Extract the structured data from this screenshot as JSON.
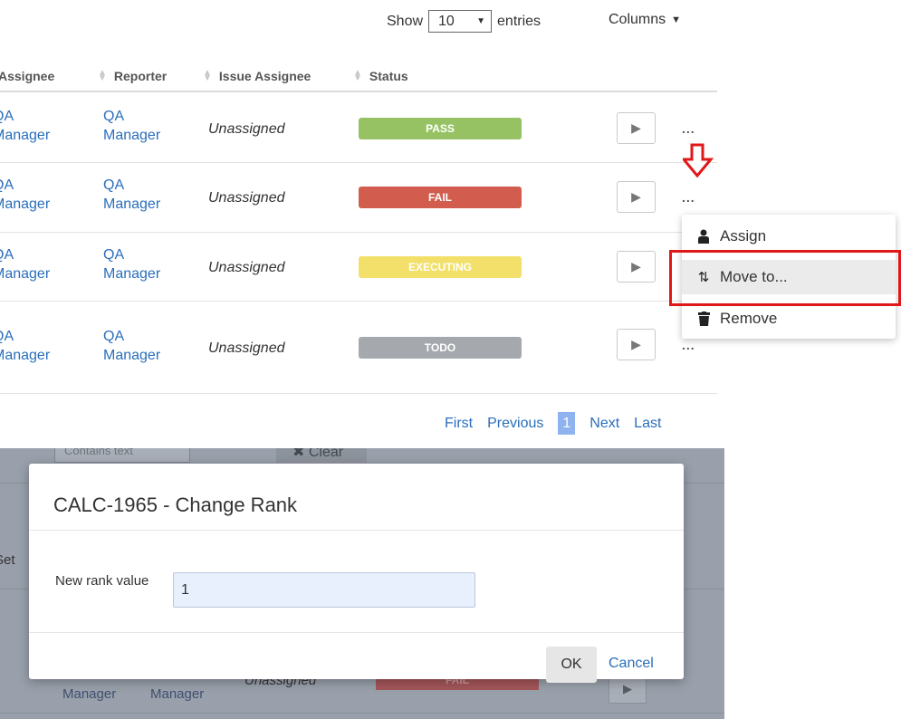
{
  "controls": {
    "show_label": "Show",
    "entries_value": "10",
    "entries_label": "entries",
    "columns_label": "Columns"
  },
  "table": {
    "headers": [
      "Assignee",
      "Reporter",
      "Issue Assignee",
      "Status"
    ],
    "rows": [
      {
        "assignee_line1": "QA",
        "assignee_line2": "Manager",
        "reporter_line1": "QA",
        "reporter_line2": "Manager",
        "issue_assignee": "Unassigned",
        "status": "PASS"
      },
      {
        "assignee_line1": "QA",
        "assignee_line2": "Manager",
        "reporter_line1": "QA",
        "reporter_line2": "Manager",
        "issue_assignee": "Unassigned",
        "status": "FAIL"
      },
      {
        "assignee_line1": "QA",
        "assignee_line2": "Manager",
        "reporter_line1": "QA",
        "reporter_line2": "Manager",
        "issue_assignee": "Unassigned",
        "status": "EXECUTING"
      },
      {
        "assignee_line1": "QA",
        "assignee_line2": "Manager",
        "reporter_line1": "QA",
        "reporter_line2": "Manager",
        "issue_assignee": "Unassigned",
        "status": "TODO"
      }
    ],
    "status_colors": {
      "PASS": "#96c263",
      "FAIL": "#d25c4e",
      "EXECUTING": "#f2e06a",
      "TODO": "#a5a9ae"
    },
    "more_label": "..."
  },
  "menu": {
    "items": [
      {
        "label": "Assign",
        "icon": "user-icon"
      },
      {
        "label": "Move to...",
        "icon": "sort-arrows-icon"
      },
      {
        "label": "Remove",
        "icon": "trash-icon"
      }
    ],
    "highlight_color": "#e01818"
  },
  "pagination": {
    "first": "First",
    "previous": "Previous",
    "current": "1",
    "next": "Next",
    "last": "Last"
  },
  "background": {
    "filter_placeholder": "Contains text",
    "clear_label": "Clear",
    "row_text_1": "Manager",
    "row_text_2": "Manager",
    "row_assignee": "Unassigned",
    "row_status": "FAIL",
    "partial_label": "Set"
  },
  "modal": {
    "title": "CALC-1965 - Change Rank",
    "rank_label": "New rank value",
    "rank_value": "1",
    "ok_label": "OK",
    "cancel_label": "Cancel"
  }
}
